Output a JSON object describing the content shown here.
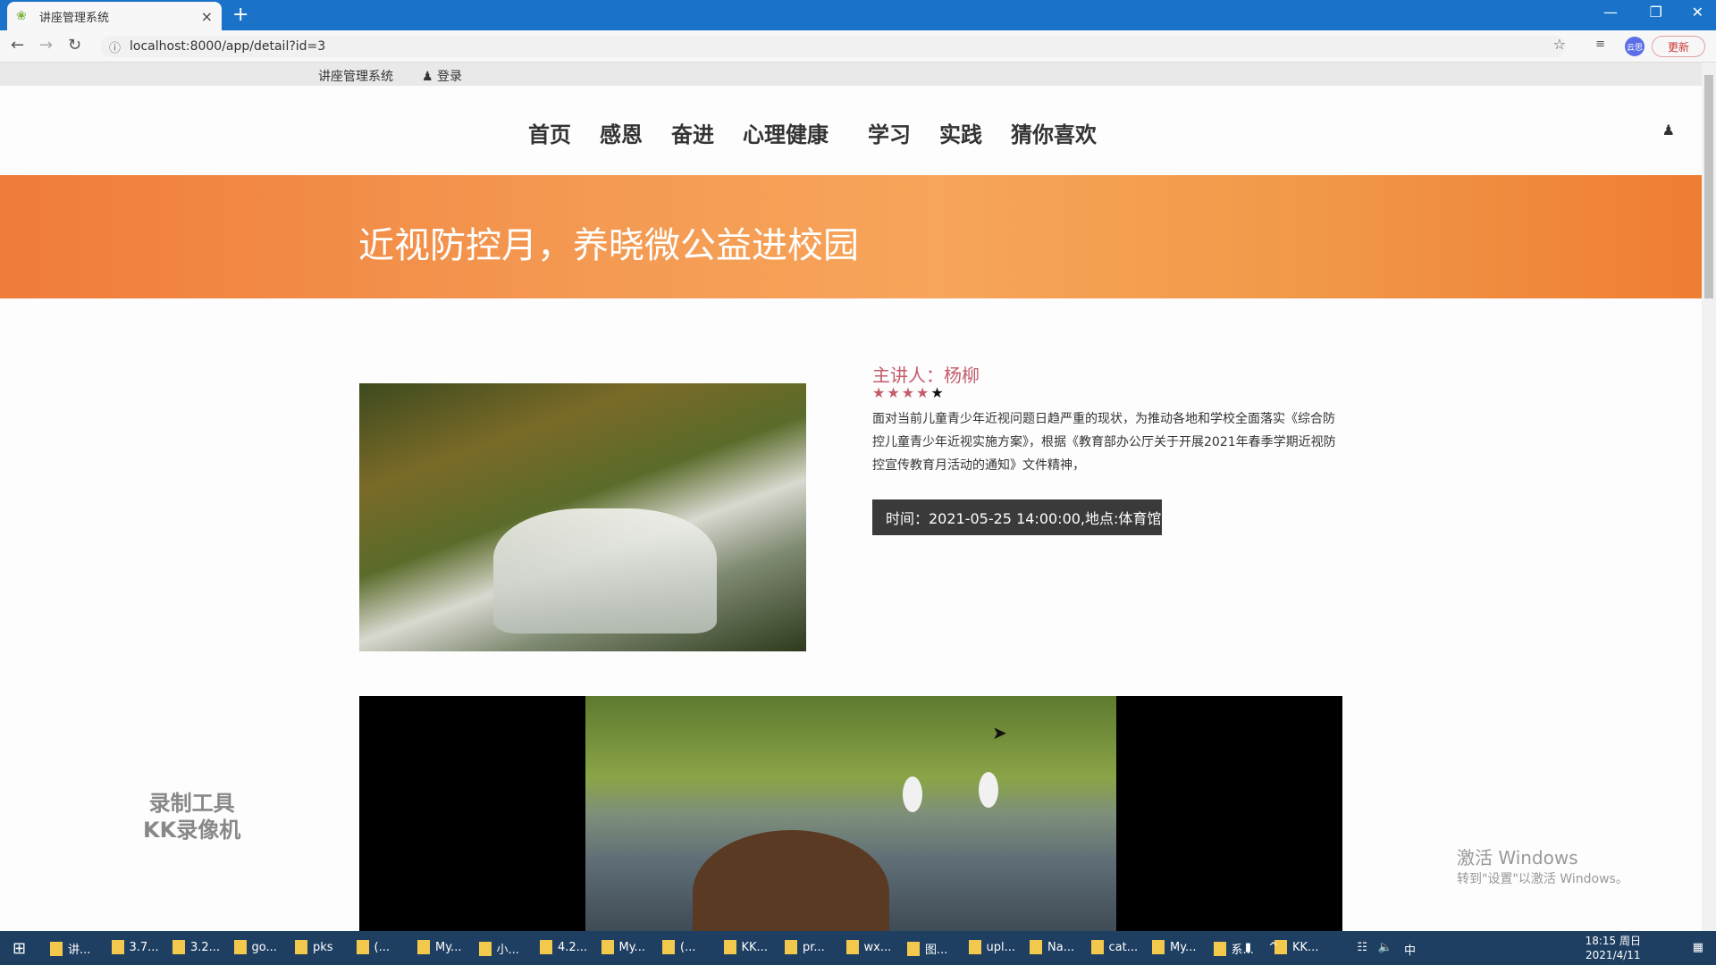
{
  "browser": {
    "tab_title": "讲座管理系统",
    "tab_close": "×",
    "new_tab": "+",
    "url": "localhost:8000/app/detail?id=3",
    "update_label": "更新",
    "profile_label": "云思",
    "icons": [
      "back-icon",
      "forward-icon",
      "reload-icon",
      "info-icon",
      "star-icon",
      "reading-list-icon"
    ]
  },
  "topbar": {
    "site_name": "讲座管理系统",
    "login_label": "登录"
  },
  "nav": {
    "items": [
      {
        "label": "首页"
      },
      {
        "label": "感恩"
      },
      {
        "label": "奋进"
      },
      {
        "label": "心理健康"
      },
      {
        "label": "学习"
      },
      {
        "label": "实践"
      },
      {
        "label": "猜你喜欢"
      }
    ]
  },
  "banner": {
    "title": "近视防控月，养晓微公益进校园"
  },
  "detail": {
    "speaker": "主讲人：杨柳",
    "rating": 4,
    "rating_max": 5,
    "description": "面对当前儿童青少年近视问题日趋严重的现状，为推动各地和学校全面落实《综合防控儿童青少年近视实施方案》，根据《教育部办公厅关于开展2021年春季学期近视防控宣传教育月活动的通知》文件精神，",
    "time_location": "时间：2021-05-25 14:00:00,地点:体育馆"
  },
  "overlay": {
    "watermark_line1": "录制工具",
    "watermark_line2": "KK录像机",
    "activate_line1": "激活 Windows",
    "activate_line2": "转到\"设置\"以激活 Windows。"
  },
  "taskbar": {
    "items": [
      "讲...",
      "3.7...",
      "3.2...",
      "go...",
      "pks",
      "(...",
      "My...",
      "小...",
      "4.2...",
      "My...",
      "(...",
      "KK...",
      "pr...",
      "wx...",
      "图...",
      "upl...",
      "Na...",
      "cat...",
      "My...",
      "系...",
      "KK..."
    ],
    "time": "18:15 周日",
    "date": "2021/4/11",
    "ime": "中"
  }
}
